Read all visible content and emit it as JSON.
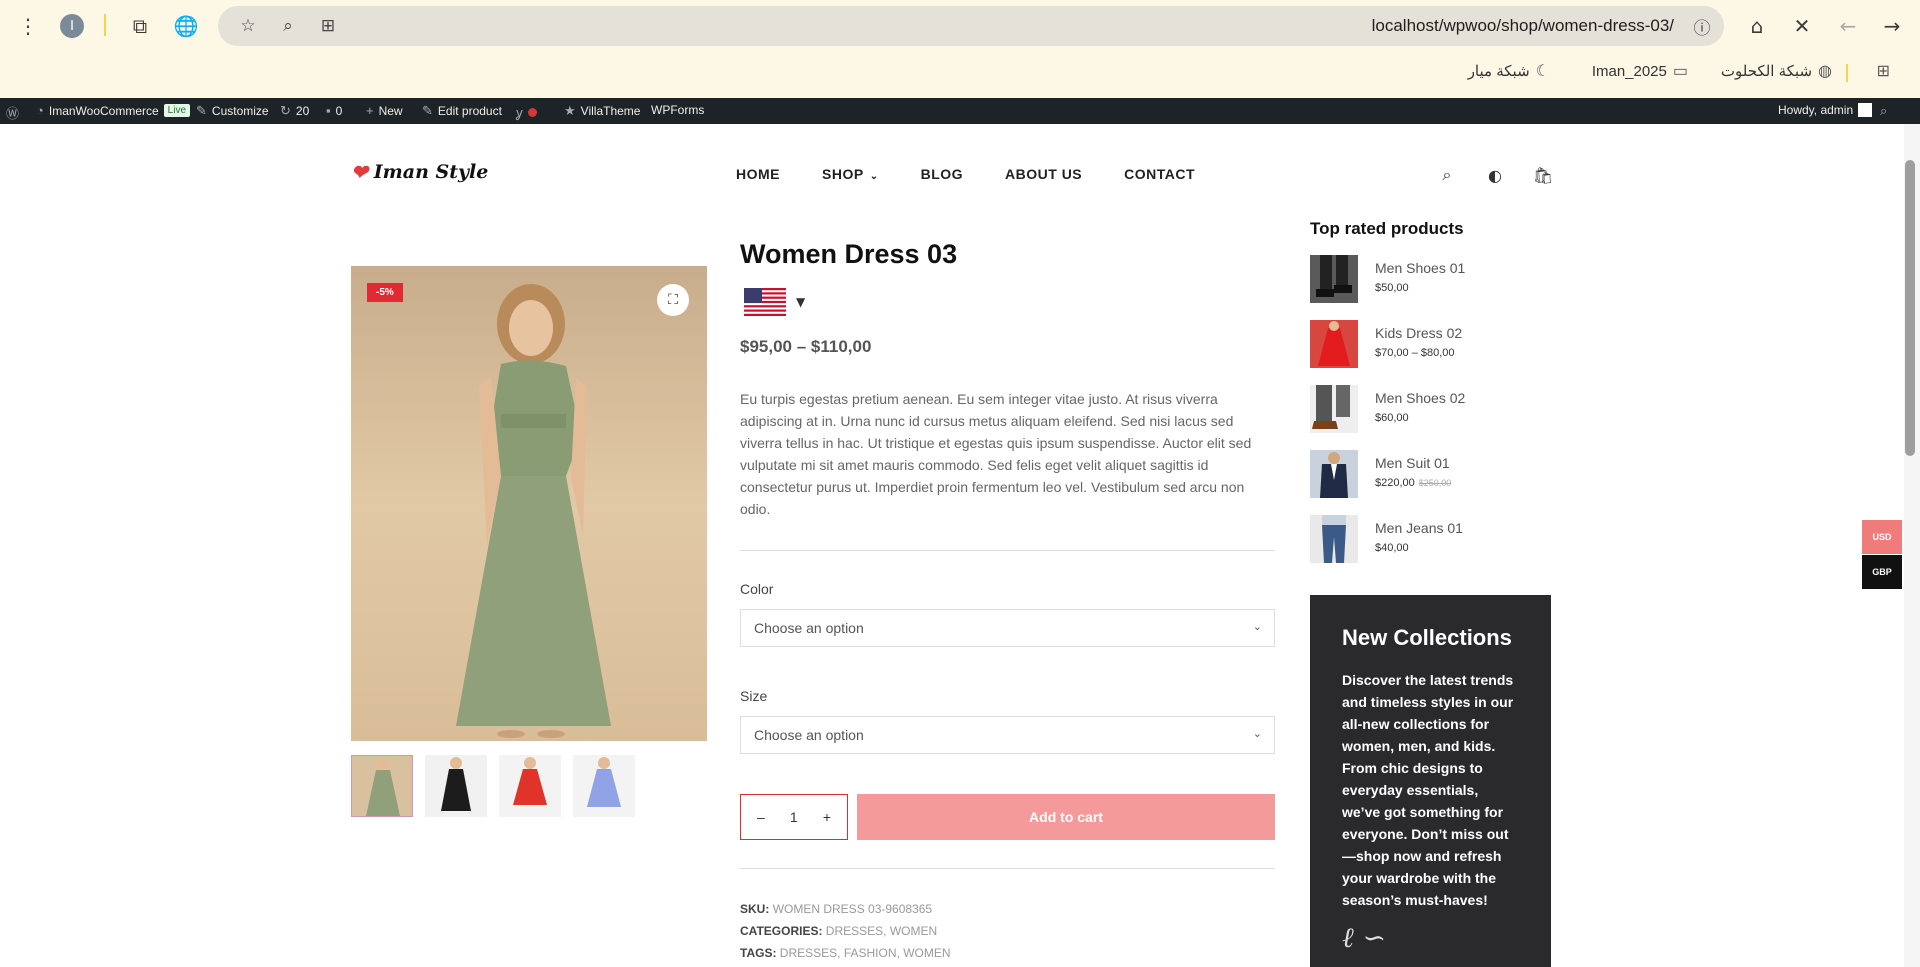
{
  "browser": {
    "url_host": "localhost",
    "url_path": "/wpwoo/shop/women-dress-03/",
    "profile_initial": "I",
    "bookmarks": [
      {
        "label": "شبكة الكحلوت",
        "icon": "globe-icon"
      },
      {
        "label": "Iman_2025",
        "icon": "folder-icon"
      },
      {
        "label": "شبكة ميار",
        "icon": "moon-icon"
      }
    ]
  },
  "adminbar": {
    "site_name": "ImanWooCommerce",
    "live_label": "Live",
    "customize": "Customize",
    "updates_count": "20",
    "comments_count": "0",
    "new_label": "New",
    "edit_product": "Edit product",
    "villatheme": "VillaTheme",
    "wpforms": "WPForms",
    "howdy": "Howdy, admin"
  },
  "header": {
    "logo_text": "Iman Style",
    "nav": [
      "HOME",
      "SHOP",
      "BLOG",
      "ABOUT US",
      "CONTACT"
    ]
  },
  "gallery": {
    "sale_badge": "-5%",
    "thumb_colors": [
      "#8fa07a",
      "#1c1c1c",
      "#e0342b",
      "#8fa3e6"
    ]
  },
  "product": {
    "title": "Women Dress 03",
    "price": "$95,00 – $110,00",
    "description": "Eu turpis egestas pretium aenean. Eu sem integer vitae justo. At risus viverra adipiscing at in. Urna nunc id cursus metus aliquam eleifend. Sed nisi lacus sed viverra tellus in hac. Ut tristique et egestas quis ipsum suspendisse. Auctor elit sed vulputate mi sit amet mauris commodo. Sed felis eget velit aliquet sagittis id consectetur purus ut. Imperdiet proin fermentum leo vel. Vestibulum sed arcu non odio.",
    "color_label": "Color",
    "size_label": "Size",
    "select_placeholder": "Choose an option",
    "quantity": "1",
    "add_to_cart": "Add to cart",
    "sku_label": "SKU:",
    "sku": "WOMEN DRESS 03-9608365",
    "categories_label": "CATEGORIES:",
    "categories": [
      "DRESSES",
      "WOMEN"
    ],
    "tags_label": "TAGS:",
    "tags": [
      "DRESSES",
      "FASHION",
      "WOMEN"
    ]
  },
  "sidebar": {
    "title": "Top rated products",
    "items": [
      {
        "name": "Men Shoes 01",
        "price": "$50,00",
        "old_price": ""
      },
      {
        "name": "Kids Dress 02",
        "price": "$70,00 – $80,00",
        "old_price": ""
      },
      {
        "name": "Men Shoes 02",
        "price": "$60,00",
        "old_price": ""
      },
      {
        "name": "Men Suit 01",
        "price": "$220,00",
        "old_price": "$250,00"
      },
      {
        "name": "Men Jeans 01",
        "price": "$40,00",
        "old_price": ""
      }
    ],
    "collections_title": "New Collections",
    "collections_text": "Discover the latest trends and timeless styles in our all-new collections for women, men, and kids. From chic designs to everyday essentials, we’ve got something for everyone. Don’t miss out—shop now and refresh your wardrobe with the season’s must-haves!"
  },
  "currency": {
    "usd": "USD",
    "gbp": "GBP"
  },
  "colors": {
    "accent": "#e02b35",
    "button": "#f49a9a",
    "adminbar": "#1d2327"
  }
}
